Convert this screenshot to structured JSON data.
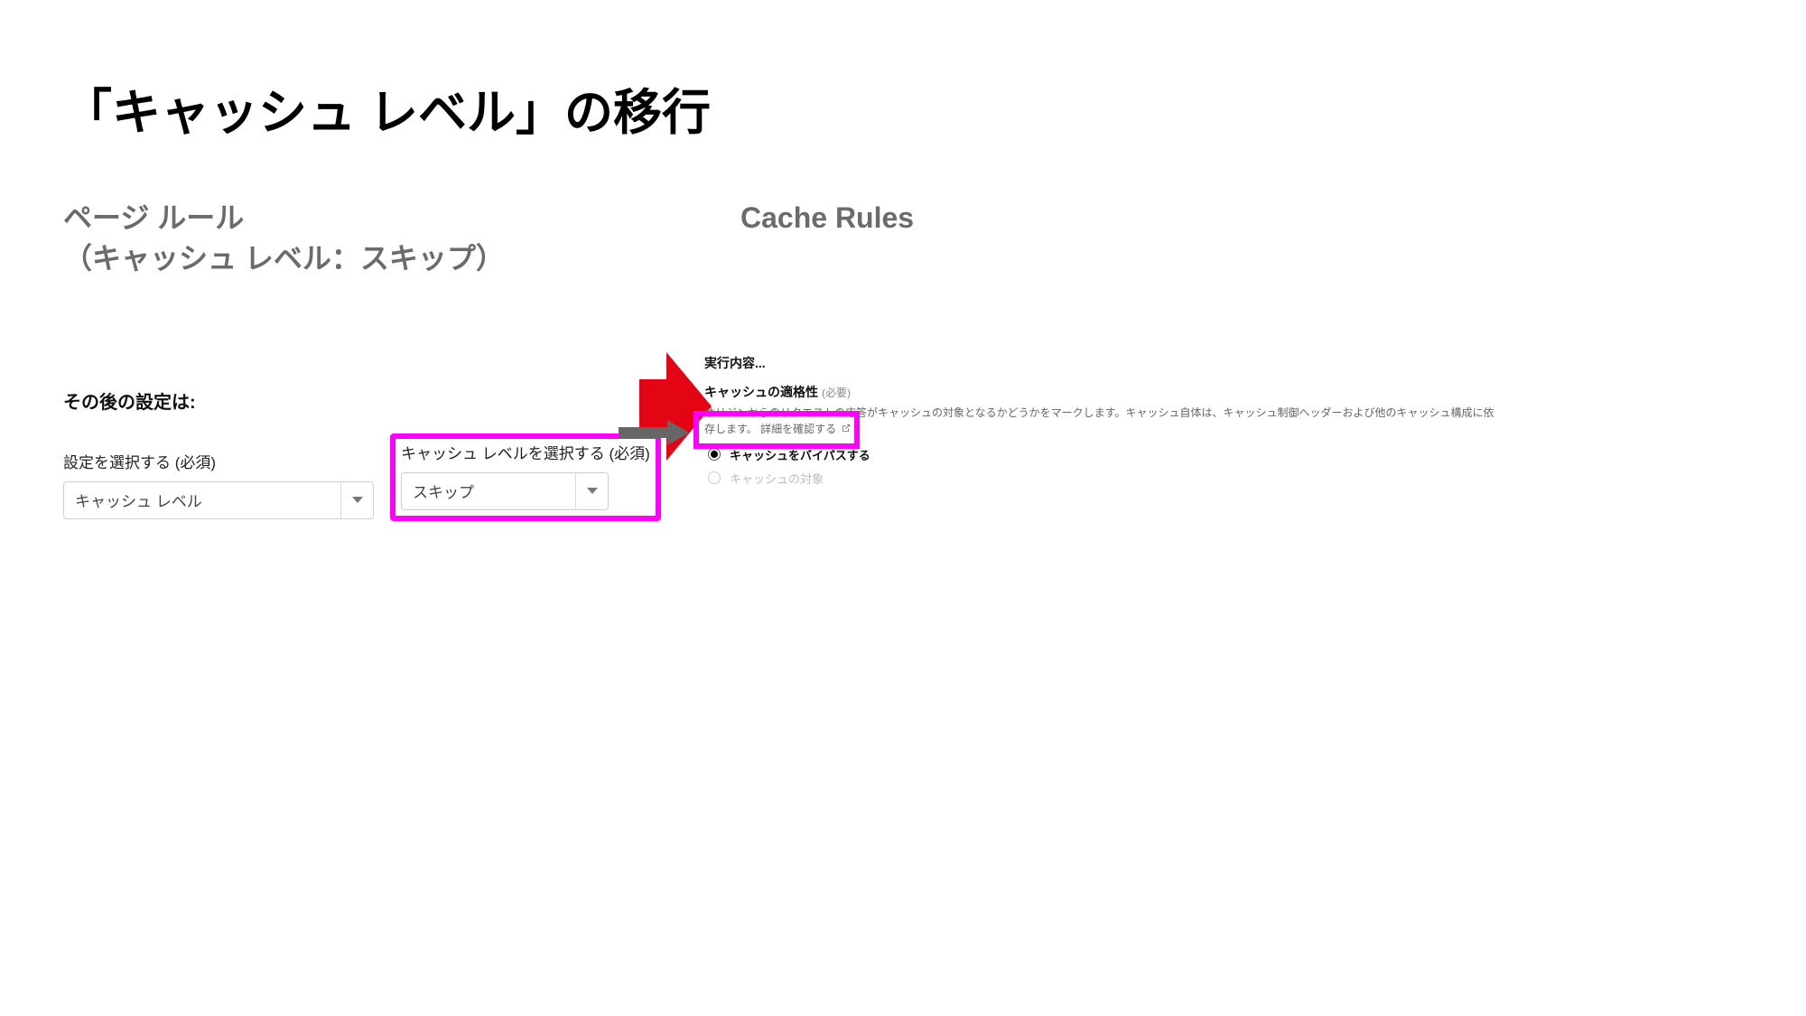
{
  "title": "「キャッシュ レベル」の移行",
  "left": {
    "heading_line1": "ページ ルール",
    "heading_line2": "（キャッシュ レベル：スキップ）",
    "panel_title": "その後の設定は:",
    "field_a": {
      "label": "設定を選択する (必須)",
      "value": "キャッシュ レベル"
    },
    "field_b": {
      "label": "キャッシュ レベルを選択する (必須)",
      "value": "スキップ"
    }
  },
  "right": {
    "heading": "Cache Rules",
    "exec_label": "実行内容...",
    "eligibility_title": "キャッシュの適格性",
    "required_tag": "(必要)",
    "description_line1": "オリジンからのリクエストの応答がキャッシュの対象となるかどうかをマークします。キャッシュ自体は、キャッシュ制御ヘッダーおよび他のキャッシュ構成に依",
    "description_line2_prefix": "存します。",
    "description_link": "詳細を確認する",
    "option_bypass": "キャッシュをバイパスする",
    "option_eligible": "キャッシュの対象"
  }
}
